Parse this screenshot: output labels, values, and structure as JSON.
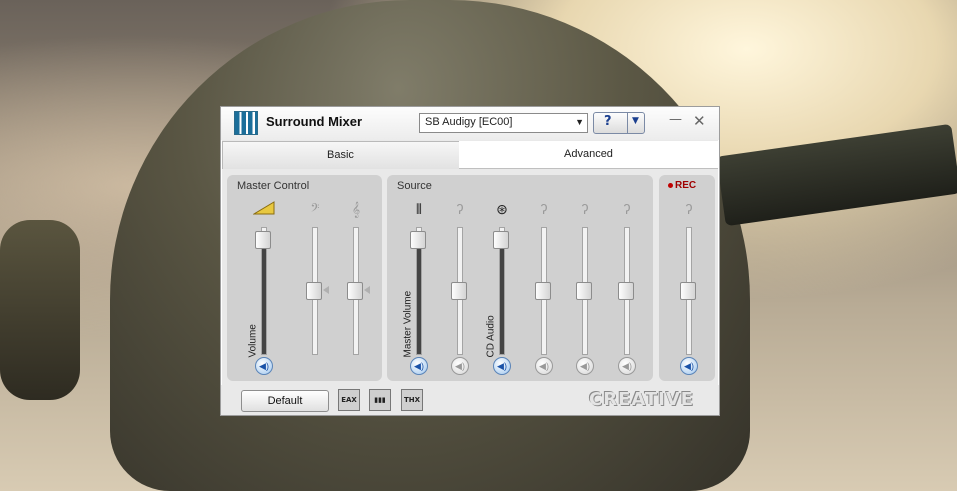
{
  "window": {
    "title": "Surround Mixer",
    "device": "SB Audigy [EC00]",
    "help_label": "?",
    "minimize_label": "—",
    "close_label": "✕"
  },
  "tabs": [
    {
      "label": "Basic",
      "selected": true
    },
    {
      "label": "Advanced",
      "selected": false
    }
  ],
  "master_control": {
    "title": "Master Control",
    "volume_label": "Volume",
    "volume_level": 0.96,
    "bass_level": 0.5,
    "treble_level": 0.5
  },
  "source": {
    "title": "Source",
    "channels": [
      {
        "label": "Master Volume",
        "level": 0.96,
        "active": true
      },
      {
        "label": "",
        "level": 0.5,
        "active": false
      },
      {
        "label": "CD Audio",
        "level": 0.96,
        "active": true
      },
      {
        "label": "",
        "level": 0.5,
        "active": false
      },
      {
        "label": "",
        "level": 0.5,
        "active": false
      },
      {
        "label": "",
        "level": 0.5,
        "active": false
      }
    ]
  },
  "rec": {
    "title": "REC",
    "level": 0.5
  },
  "bottom": {
    "default_label": "Default",
    "eax_label": "EAX",
    "thx_label": "THX",
    "logo": "CREATIVE"
  },
  "icons": {
    "speaker": "speaker-icon",
    "bass": "bass-clef-icon",
    "treble": "treble-clef-icon",
    "ear": "ear-icon"
  }
}
